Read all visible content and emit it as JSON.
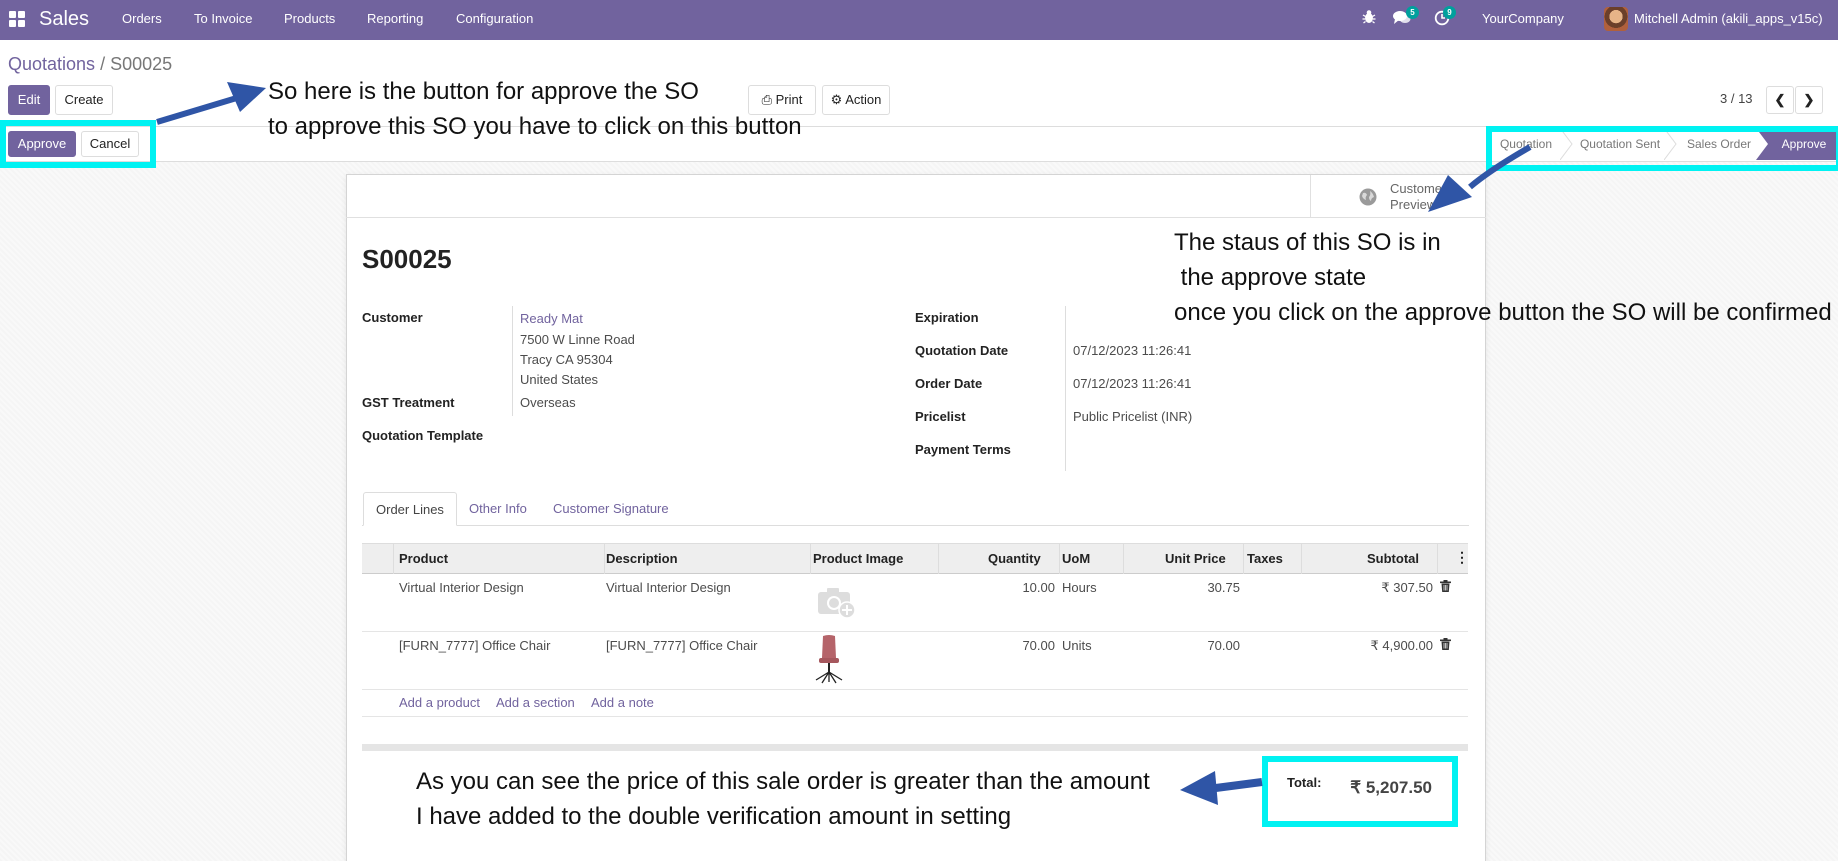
{
  "navbar": {
    "app_name": "Sales",
    "menu": [
      "Orders",
      "To Invoice",
      "Products",
      "Reporting",
      "Configuration"
    ],
    "messages_count": "5",
    "activities_count": "9",
    "company": "YourCompany",
    "user": "Mitchell Admin (akili_apps_v15c)",
    "color": "#71639e"
  },
  "breadcrumb": {
    "parent": "Quotations",
    "separator": "/",
    "current": "S00025"
  },
  "control": {
    "edit": "Edit",
    "create": "Create",
    "print": "Print",
    "action": "Action",
    "pager": "3 / 13"
  },
  "status_buttons": {
    "approve": "Approve",
    "cancel": "Cancel"
  },
  "stages": [
    "Quotation",
    "Quotation Sent",
    "Sales Order",
    "Approve"
  ],
  "active_stage": "Approve",
  "preview": {
    "line1": "Customer",
    "line2": "Preview"
  },
  "order": {
    "name": "S00025",
    "labels": {
      "customer": "Customer",
      "gst": "GST Treatment",
      "template": "Quotation Template",
      "expiration": "Expiration",
      "quotation_date": "Quotation Date",
      "order_date": "Order Date",
      "pricelist": "Pricelist",
      "payment_terms": "Payment Terms"
    },
    "customer_name": "Ready Mat",
    "address1": "7500 W Linne Road",
    "address2": "Tracy CA 95304",
    "address3": "United States",
    "gst_value": "Overseas",
    "quotation_date": "07/12/2023 11:26:41",
    "order_date": "07/12/2023 11:26:41",
    "pricelist": "Public Pricelist (INR)"
  },
  "tabs": [
    "Order Lines",
    "Other Info",
    "Customer Signature"
  ],
  "table": {
    "headers": [
      "Product",
      "Description",
      "Product Image",
      "Quantity",
      "UoM",
      "Unit Price",
      "Taxes",
      "Subtotal"
    ],
    "rows": [
      {
        "product": "Virtual Interior Design",
        "description": "Virtual Interior Design",
        "quantity": "10.00",
        "uom": "Hours",
        "unit_price": "30.75",
        "subtotal": "₹ 307.50"
      },
      {
        "product": "[FURN_7777] Office Chair",
        "description": "[FURN_7777] Office Chair",
        "quantity": "70.00",
        "uom": "Units",
        "unit_price": "70.00",
        "subtotal": "₹ 4,900.00"
      }
    ],
    "add_links": [
      "Add a product",
      "Add a section",
      "Add a note"
    ]
  },
  "total": {
    "label": "Total:",
    "value": "₹ 5,207.50"
  },
  "annotations": {
    "approve_line1": "So here is the button for approve the SO",
    "approve_line2": "to approve this SO you have to click on this button",
    "status_line1": "The staus of this SO is in",
    "status_line2": " the approve state",
    "status_line3": "once you click on the approve button the SO will be confirmed",
    "price_line1": "As you can see the price of this sale order is greater than the amount",
    "price_line2": "I have added to the double verification amount in setting",
    "highlight_color": "#00f2f2",
    "arrow_color": "#2f55a6"
  }
}
